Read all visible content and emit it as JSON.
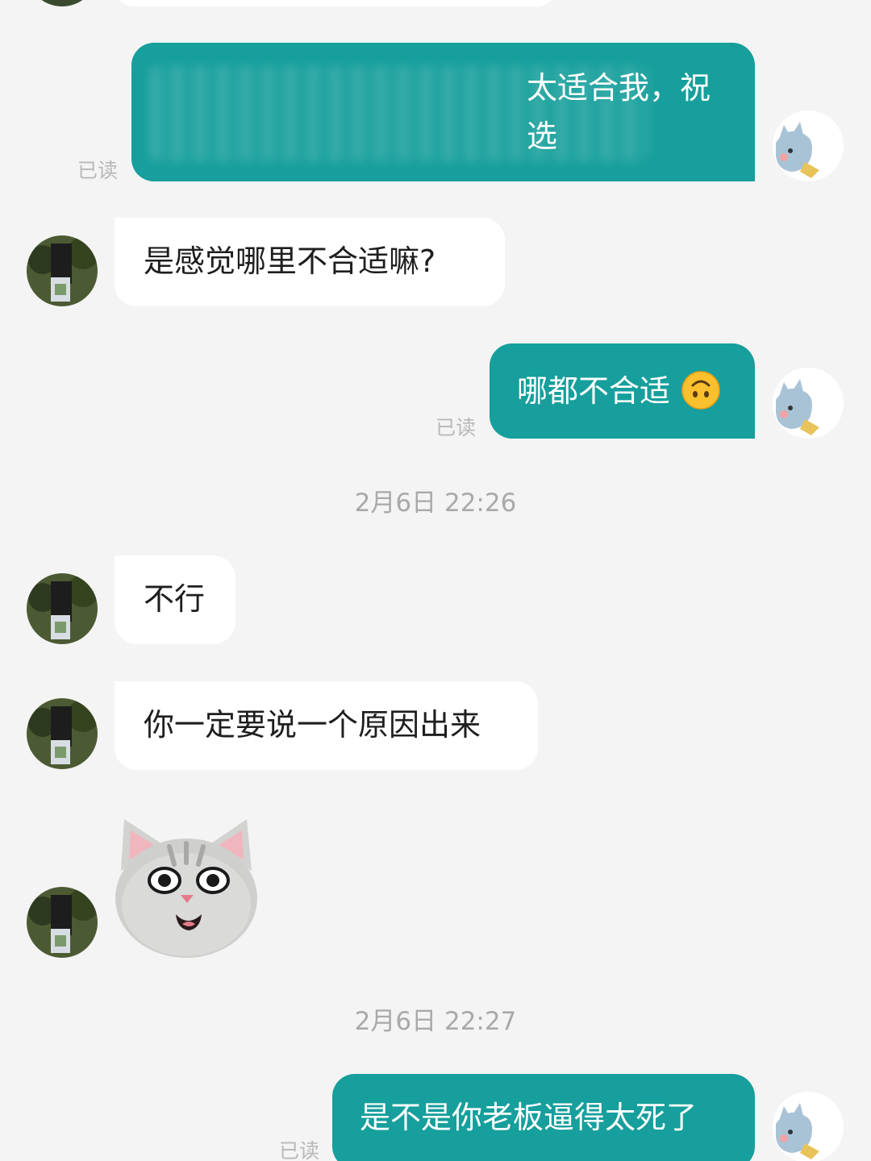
{
  "messages": {
    "m1": {
      "visible_text_line1": "太适合我，祝",
      "visible_text_line2": "选",
      "status": "已读"
    },
    "m2": {
      "text": "是感觉哪里不合适嘛?"
    },
    "m3": {
      "text": "哪都不合适",
      "status": "已读"
    },
    "ts1": "2月6日 22:26",
    "m4": {
      "text": "不行"
    },
    "m5": {
      "text": "你一定要说一个原因出来"
    },
    "m6": {
      "sticker": "cat-face-sticker"
    },
    "ts2": "2月6日 22:27",
    "m7": {
      "text": "是不是你老板逼得太死了",
      "status": "已读"
    }
  },
  "icons": {
    "emoji": "upside-down-face-emoji",
    "self_avatar": "cartoon-animal-avatar",
    "contact_avatar": "person-photo-avatar"
  },
  "colors": {
    "background": "#f4f4f4",
    "outgoing_bubble": "#169f9c",
    "incoming_bubble": "#ffffff",
    "read_receipt": "#b8b8b8",
    "timestamp": "#a9a9a9"
  }
}
